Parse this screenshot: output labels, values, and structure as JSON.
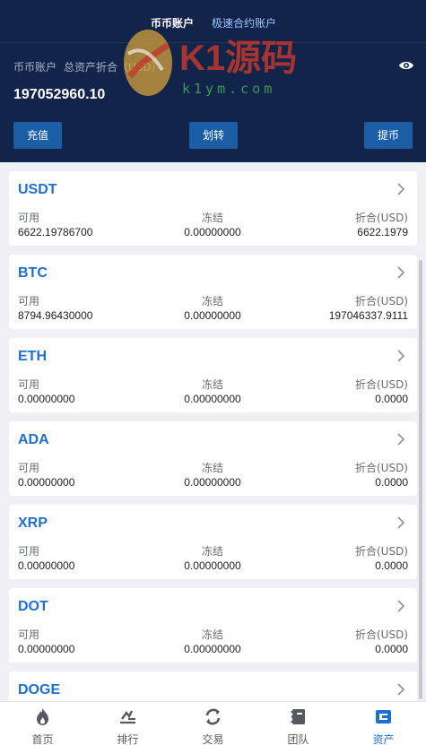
{
  "tabs": {
    "active": "币币账户",
    "inactive": "极速合约账户"
  },
  "account": {
    "label": "币币账户",
    "total_label": "总资产折合（USD）",
    "total_value": "197052960.10"
  },
  "actions": {
    "deposit": "充值",
    "transfer": "划转",
    "withdraw": "提币"
  },
  "watermark": {
    "brand": "K1源码",
    "domain": "k1ym.com"
  },
  "columns": {
    "available": "可用",
    "frozen": "冻结",
    "usd": "折合(USD)"
  },
  "assets": [
    {
      "name": "USDT",
      "available": "6622.19786700",
      "frozen": "0.00000000",
      "usd": "6622.1979"
    },
    {
      "name": "BTC",
      "available": "8794.96430000",
      "frozen": "0.00000000",
      "usd": "197046337.9111"
    },
    {
      "name": "ETH",
      "available": "0.00000000",
      "frozen": "0.00000000",
      "usd": "0.0000"
    },
    {
      "name": "ADA",
      "available": "0.00000000",
      "frozen": "0.00000000",
      "usd": "0.0000"
    },
    {
      "name": "XRP",
      "available": "0.00000000",
      "frozen": "0.00000000",
      "usd": "0.0000"
    },
    {
      "name": "DOT",
      "available": "0.00000000",
      "frozen": "0.00000000",
      "usd": "0.0000"
    },
    {
      "name": "DOGE",
      "available": "",
      "frozen": "",
      "usd": ""
    }
  ],
  "nav": [
    {
      "label": "首页",
      "icon": "fire-icon"
    },
    {
      "label": "排行",
      "icon": "ranking-icon"
    },
    {
      "label": "交易",
      "icon": "exchange-icon"
    },
    {
      "label": "团队",
      "icon": "team-icon"
    },
    {
      "label": "资产",
      "icon": "wallet-icon"
    }
  ],
  "colors": {
    "header_bg": "#122449",
    "accent": "#1f6fd1",
    "button_bg": "#1b5ea6",
    "tab_inactive": "#9bc8ff"
  }
}
